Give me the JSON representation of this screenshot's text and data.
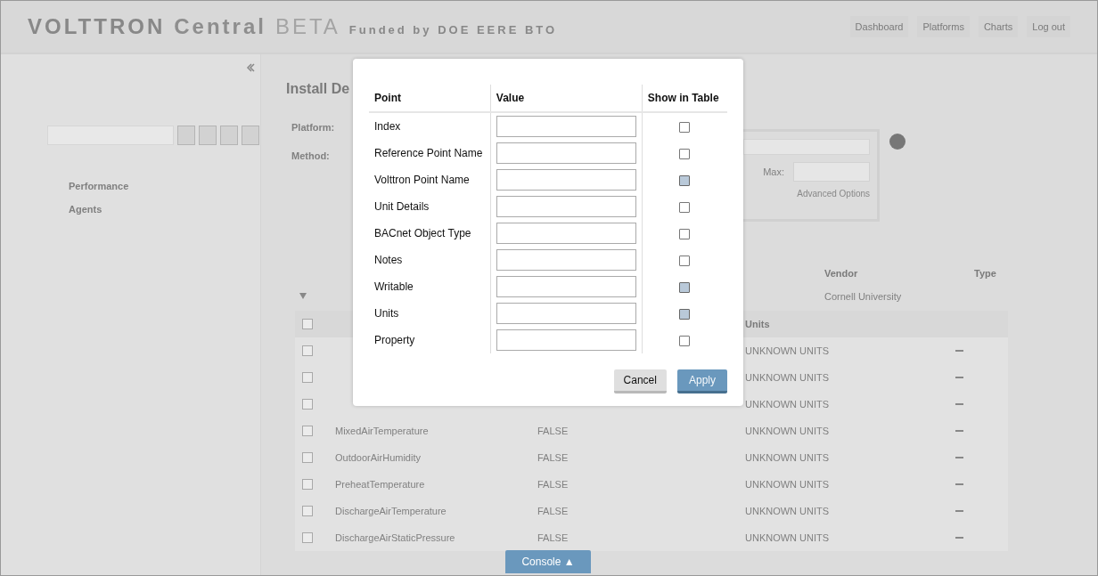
{
  "header": {
    "title": "VOLTTRON",
    "title_2": "Central",
    "badge": "BETA",
    "funding": "Funded by DOE EERE BTO",
    "nav": [
      {
        "label": "Dashboard"
      },
      {
        "label": "Platforms"
      },
      {
        "label": "Charts"
      },
      {
        "label": "Log out"
      }
    ]
  },
  "sidebar": {
    "tree": [
      {
        "label": "Performance"
      },
      {
        "label": "Agents"
      }
    ]
  },
  "main": {
    "heading": "Install De",
    "fields": [
      {
        "label": "Platform:"
      },
      {
        "label": "Method:"
      }
    ],
    "max_label": "Max:",
    "advanced_link": "Advanced Options",
    "device_columns": [
      {
        "label": "Vendor"
      },
      {
        "label": "Type"
      }
    ],
    "device_vendor": "Cornell University",
    "select_all_checked": false,
    "units_header": "Units",
    "rows": [
      {
        "checked": false,
        "name": "",
        "value": "",
        "units": "UNKNOWN UNITS"
      },
      {
        "checked": false,
        "name": "",
        "value": "",
        "units": "UNKNOWN UNITS"
      },
      {
        "checked": false,
        "name": "",
        "value": "",
        "units": "UNKNOWN UNITS"
      },
      {
        "checked": false,
        "name": "MixedAirTemperature",
        "value": "FALSE",
        "units": "UNKNOWN UNITS"
      },
      {
        "checked": false,
        "name": "OutdoorAirHumidity",
        "value": "FALSE",
        "units": "UNKNOWN UNITS"
      },
      {
        "checked": false,
        "name": "PreheatTemperature",
        "value": "FALSE",
        "units": "UNKNOWN UNITS"
      },
      {
        "checked": false,
        "name": "DischargeAirTemperature",
        "value": "FALSE",
        "units": "UNKNOWN UNITS"
      },
      {
        "checked": false,
        "name": "DischargeAirStaticPressure",
        "value": "FALSE",
        "units": "UNKNOWN UNITS"
      }
    ]
  },
  "dialog": {
    "columns": [
      "Point",
      "Value",
      "Show in Table"
    ],
    "rows": [
      {
        "point": "Index",
        "checked": false
      },
      {
        "point": "Reference Point Name",
        "checked": false
      },
      {
        "point": "Volttron Point Name",
        "checked": true
      },
      {
        "point": "Unit Details",
        "checked": false
      },
      {
        "point": "BACnet Object Type",
        "checked": false
      },
      {
        "point": "Notes",
        "checked": false
      },
      {
        "point": "Writable",
        "checked": true
      },
      {
        "point": "Units",
        "checked": true
      },
      {
        "point": "Property",
        "checked": false
      }
    ],
    "buttons": [
      {
        "label": "Cancel",
        "kind": "secondary"
      },
      {
        "label": "Apply",
        "kind": "primary"
      }
    ]
  },
  "console_button": "Console ▲"
}
